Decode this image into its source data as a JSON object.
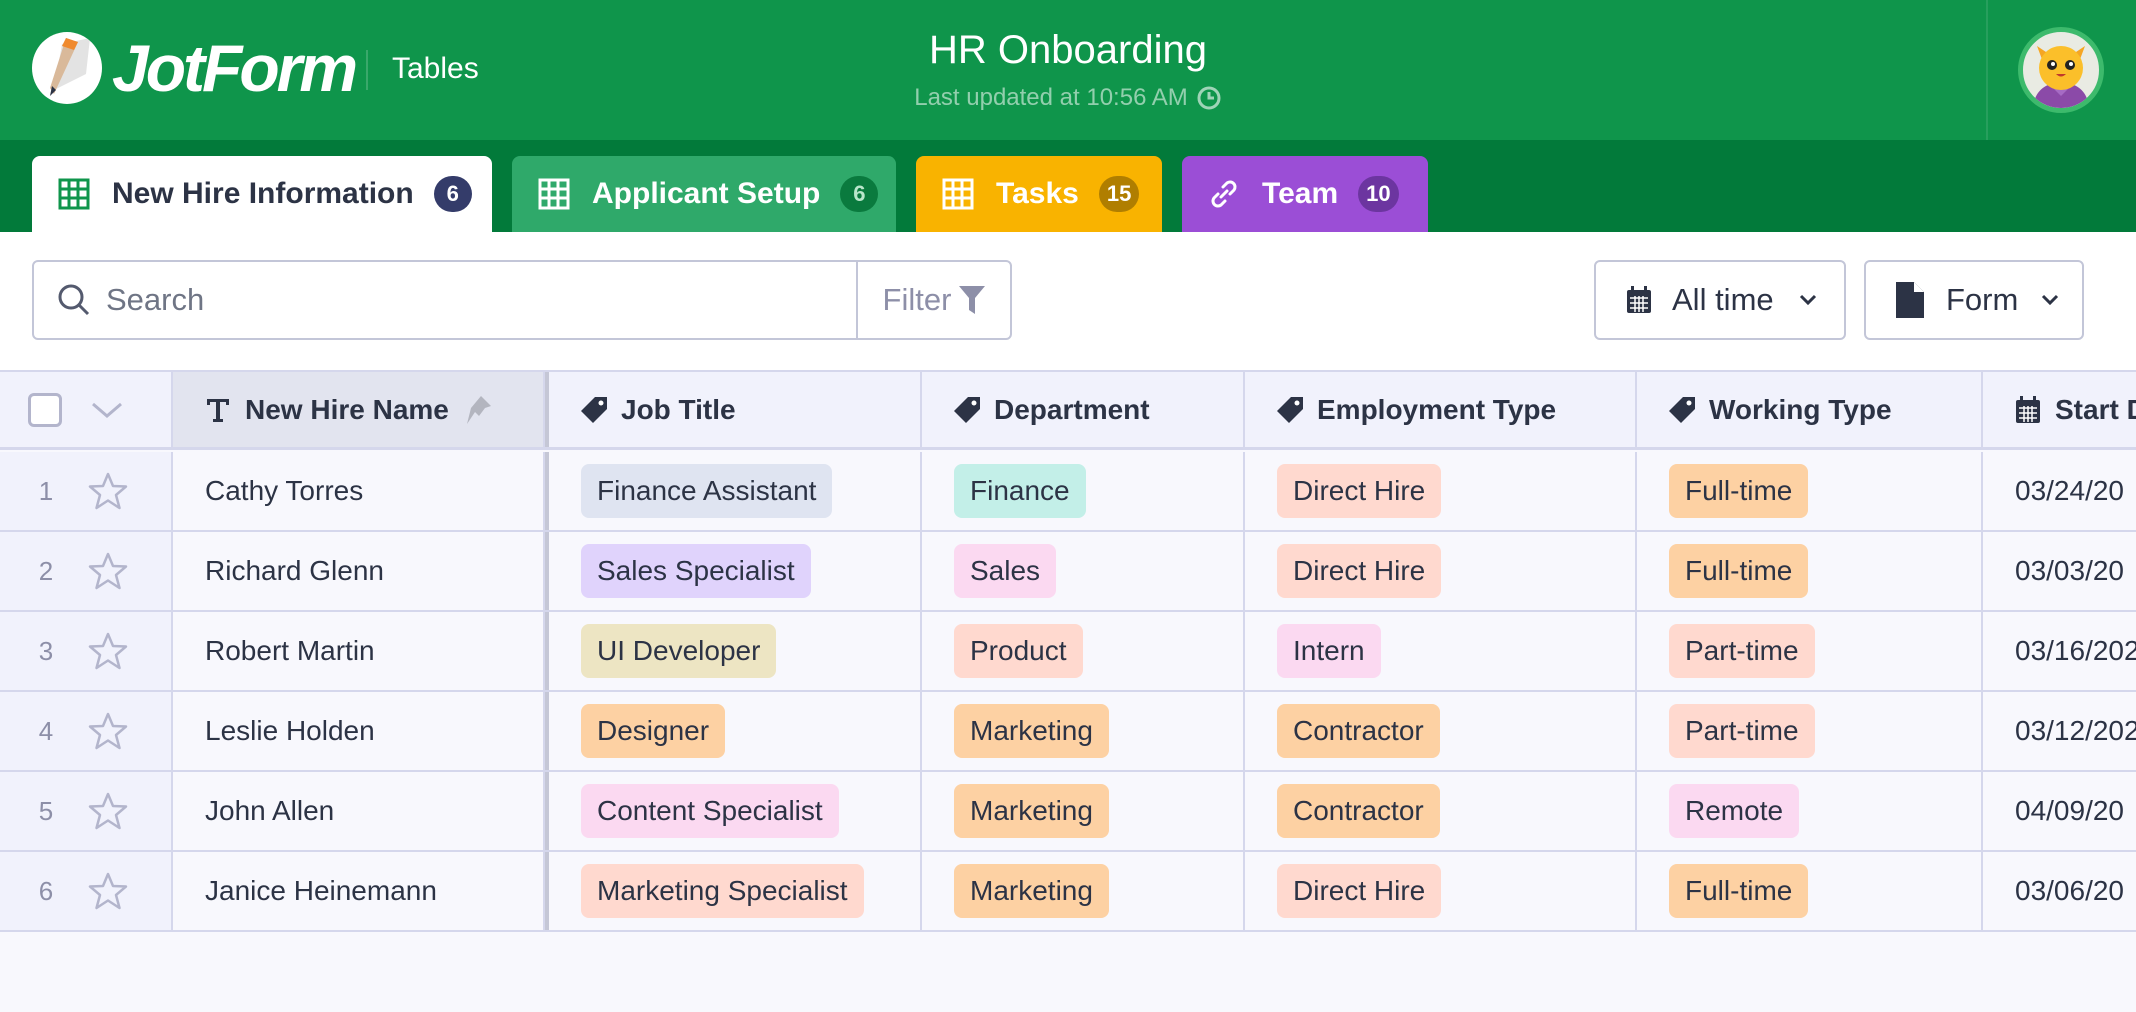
{
  "header": {
    "brand": "JotForm",
    "product": "Tables",
    "title": "HR Onboarding",
    "last_updated": "Last updated at 10:56 AM",
    "brand_color": "#0f954b"
  },
  "tabs": [
    {
      "label": "New Hire Information",
      "count": "6",
      "icon": "table-icon",
      "active": true,
      "color": "#ffffff",
      "badge_color": "#343c6a"
    },
    {
      "label": "Applicant Setup",
      "count": "6",
      "icon": "table-icon",
      "active": false,
      "color": "#2fa96a",
      "badge_color": "#0a7a3e"
    },
    {
      "label": "Tasks",
      "count": "15",
      "icon": "table-icon",
      "active": false,
      "color": "#f9b300",
      "badge_color": "#b07e00"
    },
    {
      "label": "Team",
      "count": "10",
      "icon": "link-icon",
      "active": false,
      "color": "#9b4ed6",
      "badge_color": "#6c35a0"
    }
  ],
  "toolbar": {
    "search_placeholder": "Search",
    "search_value": "",
    "filter_label": "Filter",
    "date_dropdown": "All time",
    "source_dropdown": "Form"
  },
  "table": {
    "columns": [
      {
        "label": "New Hire Name",
        "icon": "text-icon"
      },
      {
        "label": "Job Title",
        "icon": "tag-icon"
      },
      {
        "label": "Department",
        "icon": "tag-icon"
      },
      {
        "label": "Employment Type",
        "icon": "tag-icon"
      },
      {
        "label": "Working Type",
        "icon": "tag-icon"
      },
      {
        "label": "Start Date",
        "icon": "calendar-icon"
      }
    ],
    "rows": [
      {
        "num": "1",
        "name": "Cathy Torres",
        "job": {
          "text": "Finance Assistant",
          "color": "#dfe4f1"
        },
        "dept": {
          "text": "Finance",
          "color": "#c3efe8"
        },
        "emp": {
          "text": "Direct Hire",
          "color": "#ffd9cf"
        },
        "work": {
          "text": "Full-time",
          "color": "#fdd1a3"
        },
        "start": "03/24/20"
      },
      {
        "num": "2",
        "name": "Richard Glenn",
        "job": {
          "text": "Sales Specialist",
          "color": "#e0d3fc"
        },
        "dept": {
          "text": "Sales",
          "color": "#fbd9f1"
        },
        "emp": {
          "text": "Direct Hire",
          "color": "#ffd9cf"
        },
        "work": {
          "text": "Full-time",
          "color": "#fdd1a3"
        },
        "start": "03/03/20"
      },
      {
        "num": "3",
        "name": "Robert Martin",
        "job": {
          "text": "UI Developer",
          "color": "#ede5c3"
        },
        "dept": {
          "text": "Product",
          "color": "#ffd9cf"
        },
        "emp": {
          "text": "Intern",
          "color": "#fbd9f1"
        },
        "work": {
          "text": "Part-time",
          "color": "#ffd9cf"
        },
        "start": "03/16/202"
      },
      {
        "num": "4",
        "name": "Leslie Holden",
        "job": {
          "text": "Designer",
          "color": "#fdd1a3"
        },
        "dept": {
          "text": "Marketing",
          "color": "#fdd1a3"
        },
        "emp": {
          "text": "Contractor",
          "color": "#fdd1a3"
        },
        "work": {
          "text": "Part-time",
          "color": "#ffd9cf"
        },
        "start": "03/12/202"
      },
      {
        "num": "5",
        "name": "John Allen",
        "job": {
          "text": "Content Specialist",
          "color": "#fbd9f1"
        },
        "dept": {
          "text": "Marketing",
          "color": "#fdd1a3"
        },
        "emp": {
          "text": "Contractor",
          "color": "#fdd1a3"
        },
        "work": {
          "text": "Remote",
          "color": "#fbd9f1"
        },
        "start": "04/09/20"
      },
      {
        "num": "6",
        "name": "Janice Heinemann",
        "job": {
          "text": "Marketing Specialist",
          "color": "#ffd9cf"
        },
        "dept": {
          "text": "Marketing",
          "color": "#fdd1a3"
        },
        "emp": {
          "text": "Direct Hire",
          "color": "#ffd9cf"
        },
        "work": {
          "text": "Full-time",
          "color": "#fdd1a3"
        },
        "start": "03/06/20"
      }
    ]
  }
}
